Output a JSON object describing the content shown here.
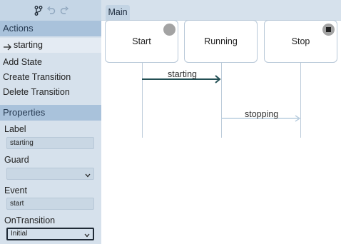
{
  "toolbar": {
    "icons": [
      "branch-icon",
      "undo-icon",
      "redo-icon"
    ]
  },
  "actions": {
    "header": "Actions",
    "selected": "starting",
    "items": [
      "Add State",
      "Create Transition",
      "Delete Transition"
    ]
  },
  "properties": {
    "header": "Properties",
    "label_title": "Label",
    "label_value": "starting",
    "guard_title": "Guard",
    "guard_value": "",
    "event_title": "Event",
    "event_value": "start",
    "ontransition_title": "OnTransition",
    "ontransition_value": "Initial"
  },
  "main": {
    "tab": "Main",
    "states": [
      "Start",
      "Running",
      "Stop"
    ],
    "transitions": [
      {
        "label": "starting",
        "from": "Start",
        "to": "Running",
        "active": true
      },
      {
        "label": "stopping",
        "from": "Running",
        "to": "Stop",
        "active": false
      }
    ]
  },
  "colors": {
    "sidebar_bg": "#d6e1ec",
    "header_bg": "#a9c2db",
    "active_arrow": "#234f54",
    "inactive_arrow": "#b9cedf"
  }
}
